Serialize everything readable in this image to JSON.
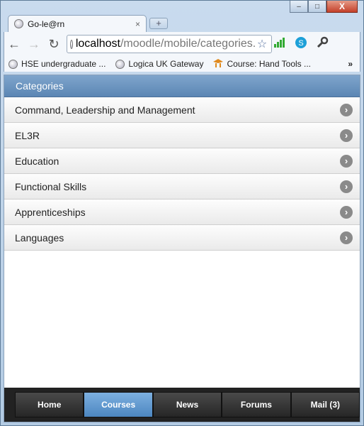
{
  "browser": {
    "tab_title": "Go-le@rn",
    "tab_close": "×",
    "new_tab": "+",
    "url_host": "localhost",
    "url_path": "/moodle/mobile/categories.ph",
    "window_controls": {
      "minimize": "–",
      "maximize": "□",
      "close": "X"
    },
    "bookmarks": [
      {
        "label": "HSE undergraduate ...",
        "icon": "globe-icon"
      },
      {
        "label": "Logica UK Gateway",
        "icon": "globe-icon"
      },
      {
        "label": "Course: Hand Tools ...",
        "icon": "moodle-icon"
      }
    ],
    "bookmarks_more": "»"
  },
  "page": {
    "header": "Categories",
    "categories": [
      {
        "label": "Command, Leadership and Management"
      },
      {
        "label": "EL3R"
      },
      {
        "label": "Education"
      },
      {
        "label": "Functional Skills"
      },
      {
        "label": "Apprenticeships"
      },
      {
        "label": "Languages"
      }
    ],
    "footer": [
      {
        "label": "Home",
        "active": false
      },
      {
        "label": "Courses",
        "active": true
      },
      {
        "label": "News",
        "active": false
      },
      {
        "label": "Forums",
        "active": false
      },
      {
        "label": "Mail (3)",
        "active": false
      }
    ]
  },
  "colors": {
    "header_blue": "#5b86b4",
    "footer_active": "#4c86c0"
  }
}
